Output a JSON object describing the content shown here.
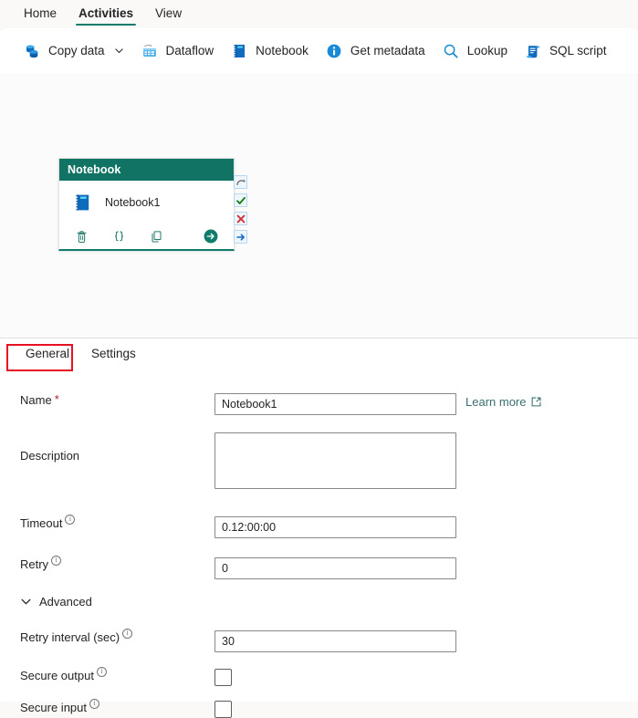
{
  "topnav": {
    "items": [
      {
        "label": "Home",
        "active": false
      },
      {
        "label": "Activities",
        "active": true
      },
      {
        "label": "View",
        "active": false
      }
    ]
  },
  "ribbon": {
    "buttons": [
      {
        "label": "Copy data",
        "icon": "copy-data-icon",
        "has_caret": true
      },
      {
        "label": "Dataflow",
        "icon": "dataflow-icon",
        "has_caret": false
      },
      {
        "label": "Notebook",
        "icon": "notebook-icon",
        "has_caret": false
      },
      {
        "label": "Get metadata",
        "icon": "info-circle-icon",
        "has_caret": false
      },
      {
        "label": "Lookup",
        "icon": "magnifier-icon",
        "has_caret": false
      },
      {
        "label": "SQL script",
        "icon": "sql-script-icon",
        "has_caret": false
      }
    ]
  },
  "canvas": {
    "node": {
      "header": "Notebook",
      "title": "Notebook1",
      "icon": "notebook-icon",
      "actions": [
        {
          "name": "delete-activity-button",
          "icon": "trash-icon"
        },
        {
          "name": "code-view-button",
          "icon": "braces-icon"
        },
        {
          "name": "duplicate-activity-button",
          "icon": "copy-icon"
        }
      ],
      "run_button": "run-activity-icon",
      "handles": [
        {
          "name": "on-skip-handle",
          "icon": "curved-arrow-icon",
          "color": "#6b6b6b"
        },
        {
          "name": "on-success-handle",
          "icon": "checkmark-icon",
          "color": "#107c10"
        },
        {
          "name": "on-failure-handle",
          "icon": "x-mark-icon",
          "color": "#d13438"
        },
        {
          "name": "on-completion-handle",
          "icon": "arrow-right-icon",
          "color": "#0f6cbd"
        }
      ]
    }
  },
  "properties": {
    "tabs": [
      {
        "label": "General",
        "active": true,
        "annotated": true
      },
      {
        "label": "Settings",
        "active": false
      }
    ],
    "fields": {
      "name": {
        "label": "Name",
        "required_mark": "*",
        "value": "Notebook1",
        "placeholder": "",
        "learn_more": "Learn more"
      },
      "description": {
        "label": "Description",
        "value": "",
        "placeholder": ""
      },
      "timeout": {
        "label": "Timeout",
        "value": "0.12:00:00",
        "placeholder": ""
      },
      "retry": {
        "label": "Retry",
        "value": "0",
        "placeholder": ""
      },
      "advanced": {
        "label": "Advanced",
        "expanded": true
      },
      "retry_interval": {
        "label": "Retry interval (sec)",
        "value": "30",
        "placeholder": ""
      },
      "secure_output": {
        "label": "Secure output",
        "checked": false
      },
      "secure_input": {
        "label": "Secure input",
        "checked": false
      }
    }
  },
  "colors": {
    "accent_teal": "#0f7b6c",
    "node_header": "#117364",
    "annotation_red": "#e81123",
    "required_red": "#a4262c",
    "link_teal": "#3b6e70"
  }
}
